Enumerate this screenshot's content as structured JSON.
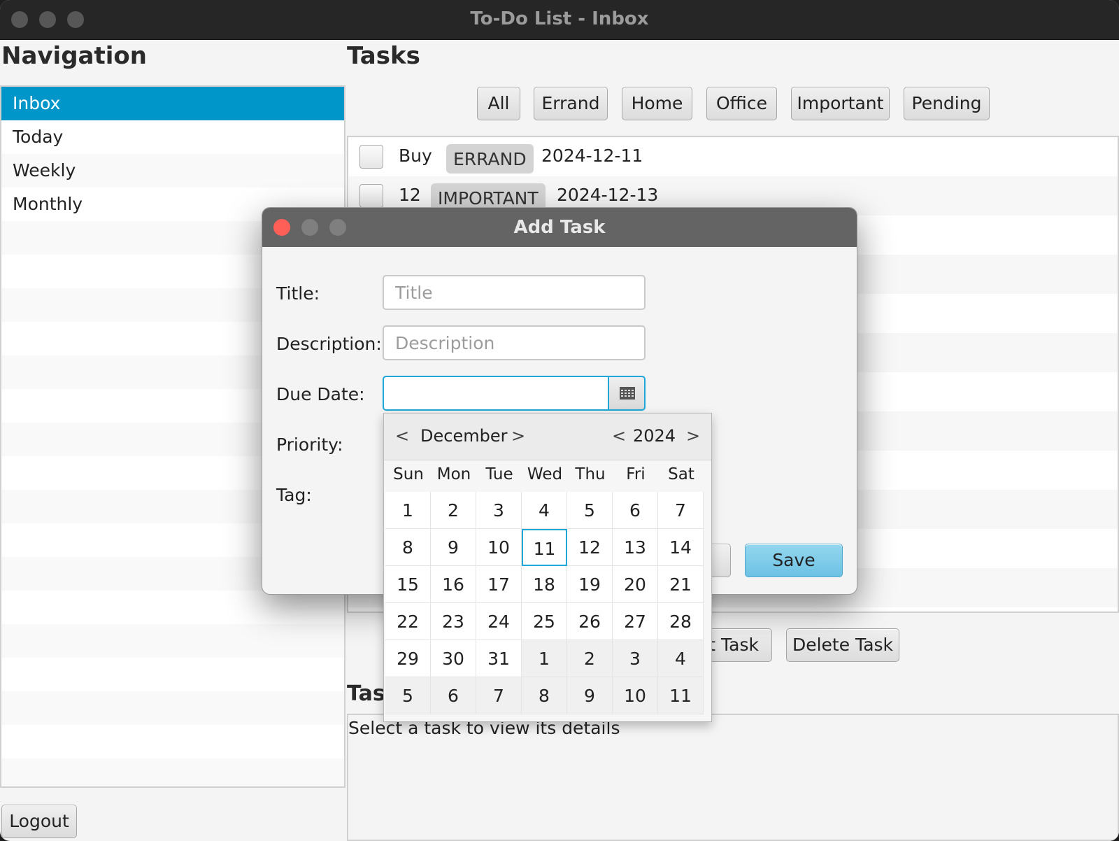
{
  "window": {
    "title": "To-Do List - Inbox"
  },
  "navigation": {
    "heading": "Navigation",
    "items": [
      "Inbox",
      "Today",
      "Weekly",
      "Monthly"
    ],
    "selected": "Inbox",
    "logout_label": "Logout"
  },
  "tasks": {
    "heading": "Tasks",
    "filters": [
      "All",
      "Errand",
      "Home",
      "Office",
      "Important",
      "Pending"
    ],
    "rows": [
      {
        "title": "Buy",
        "tag": "ERRAND",
        "date": "2024-12-11"
      },
      {
        "title": "12",
        "tag": "IMPORTANT",
        "date": "2024-12-13"
      }
    ],
    "edit_label_partial": "it Task",
    "delete_label": "Delete Task",
    "details_heading_partial": "Tas",
    "details_placeholder": "Select a task to view its details"
  },
  "dialog": {
    "title": "Add Task",
    "labels": {
      "title": "Title:",
      "description": "Description:",
      "due_date": "Due Date:",
      "priority": "Priority:",
      "tag": "Tag:"
    },
    "placeholders": {
      "title": "Title",
      "description": "Description"
    },
    "due_date_value": "",
    "save_label": "Save",
    "calendar_icon": "calendar-icon"
  },
  "calendar": {
    "month": "December",
    "year": "2024",
    "weekdays": [
      "Sun",
      "Mon",
      "Tue",
      "Wed",
      "Thu",
      "Fri",
      "Sat"
    ],
    "days": [
      [
        1,
        2,
        3,
        4,
        5,
        6,
        7
      ],
      [
        8,
        9,
        10,
        11,
        12,
        13,
        14
      ],
      [
        15,
        16,
        17,
        18,
        19,
        20,
        21
      ],
      [
        22,
        23,
        24,
        25,
        26,
        27,
        28
      ],
      [
        29,
        30,
        31,
        1,
        2,
        3,
        4
      ],
      [
        5,
        6,
        7,
        8,
        9,
        10,
        11
      ]
    ],
    "highlighted_day": 11
  },
  "colors": {
    "selection": "#0096c9",
    "focus_ring": "#1ea7d8",
    "save_button": "#7fcbe8",
    "close_button": "#ff5f57"
  }
}
